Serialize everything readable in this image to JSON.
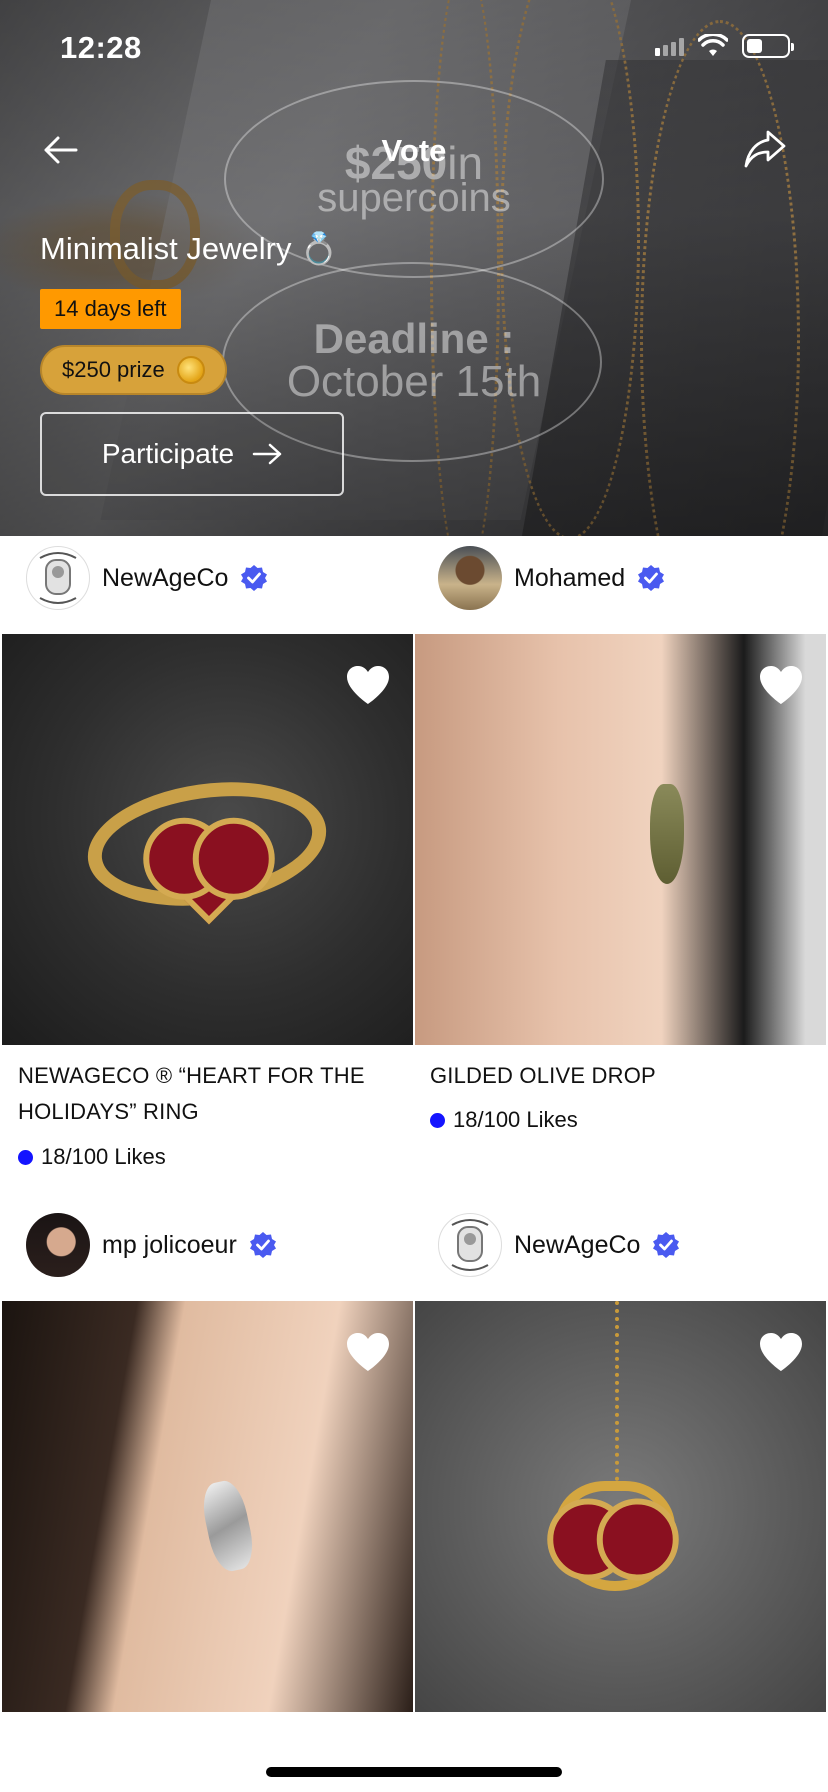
{
  "status_bar": {
    "time": "12:28"
  },
  "header": {
    "title": "Vote",
    "back_icon": "arrow-left-icon",
    "share_icon": "share-icon"
  },
  "hero": {
    "ghost_prize_amount": "$250",
    "ghost_prize_unit_suffix": "in",
    "ghost_prize_unit": "supercoins",
    "ghost_deadline_label": "Deadline :",
    "ghost_deadline_date": "October 15th",
    "challenge_title": "Minimalist Jewelry",
    "challenge_emoji": "💍",
    "days_left": "14 days left",
    "prize": "$250 prize",
    "participate_label": "Participate",
    "accent_color": "#ff9900",
    "prize_color": "#d7a23a"
  },
  "feed": {
    "accent_color": "#1414ff",
    "verified_color": "#4a5af0",
    "posts": [
      {
        "author": "NewAgeCo",
        "title": "NEWAGECO ® “HEART FOR THE HOLIDAYS” RING",
        "likes": "18/100 Likes"
      },
      {
        "author": "Mohamed",
        "title": "GILDED OLIVE DROP",
        "likes": "18/100 Likes"
      },
      {
        "author": "mp jolicoeur",
        "title": "",
        "likes": ""
      },
      {
        "author": "NewAgeCo",
        "title": "",
        "likes": ""
      }
    ]
  }
}
